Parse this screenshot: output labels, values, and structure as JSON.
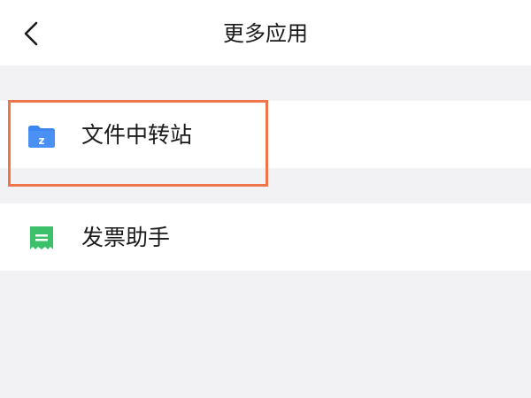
{
  "header": {
    "title": "更多应用",
    "back_icon": "chevron-left-icon"
  },
  "items": [
    {
      "label": "文件中转站",
      "icon": "folder-z-icon",
      "icon_color": "#3d85f0"
    },
    {
      "label": "发票助手",
      "icon": "receipt-icon",
      "icon_color": "#3cc16a"
    }
  ],
  "colors": {
    "highlight": "#f0744a",
    "background": "#f2f2f4"
  }
}
